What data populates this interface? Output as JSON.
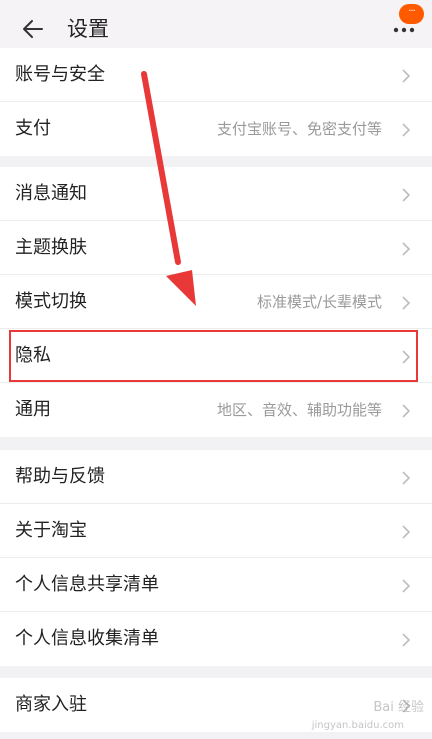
{
  "header": {
    "title": "设置",
    "back_icon": "arrow-left-icon",
    "more_icon": "more-dots-icon",
    "badge_text": "···",
    "badge_color": "#ff5a00"
  },
  "groups": [
    {
      "rows": [
        {
          "label": "账号与安全",
          "value": ""
        },
        {
          "label": "支付",
          "value": "支付宝账号、免密支付等"
        }
      ]
    },
    {
      "rows": [
        {
          "label": "消息通知",
          "value": ""
        },
        {
          "label": "主题换肤",
          "value": ""
        },
        {
          "label": "模式切换",
          "value": "标准模式/长辈模式"
        },
        {
          "label": "隐私",
          "value": ""
        },
        {
          "label": "通用",
          "value": "地区、音效、辅助功能等"
        }
      ]
    },
    {
      "rows": [
        {
          "label": "帮助与反馈",
          "value": ""
        },
        {
          "label": "关于淘宝",
          "value": ""
        },
        {
          "label": "个人信息共享清单",
          "value": ""
        },
        {
          "label": "个人信息收集清单",
          "value": ""
        }
      ]
    },
    {
      "rows": [
        {
          "label": "商家入驻",
          "value": ""
        }
      ]
    }
  ],
  "annotation": {
    "highlight_color": "#e83838",
    "highlighted_item": "隐私"
  },
  "watermark": {
    "text": "Bai 经验",
    "url": "jingyan.baidu.com"
  }
}
